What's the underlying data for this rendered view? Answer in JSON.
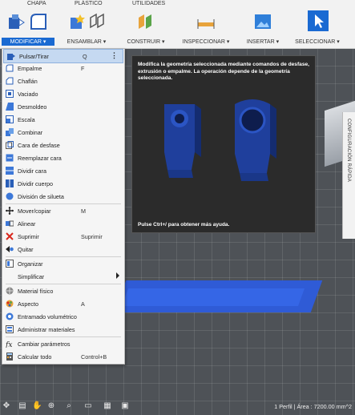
{
  "tabs": [
    "CHAPA",
    "PLÁSTICO",
    "UTILIDADES"
  ],
  "toolbar_groups": [
    {
      "label": "MODIFICAR ▾"
    },
    {
      "label": "ENSAMBLAR ▾"
    },
    {
      "label": "CONSTRUIR ▾"
    },
    {
      "label": "INSPECCIONAR ▾"
    },
    {
      "label": "INSERTAR ▾"
    },
    {
      "label": "SELECCIONAR ▾"
    }
  ],
  "menu": {
    "items": [
      {
        "label": "Pulsar/Tirar",
        "shortcut": "Q"
      },
      {
        "label": "Empalme",
        "shortcut": "F"
      },
      {
        "label": "Chaflán",
        "shortcut": ""
      },
      {
        "label": "Vaciado",
        "shortcut": ""
      },
      {
        "label": "Desmoldeo",
        "shortcut": ""
      },
      {
        "label": "Escala",
        "shortcut": ""
      },
      {
        "label": "Combinar",
        "shortcut": ""
      },
      {
        "label": "Cara de desfase",
        "shortcut": ""
      },
      {
        "label": "Reemplazar cara",
        "shortcut": ""
      },
      {
        "label": "Dividir cara",
        "shortcut": ""
      },
      {
        "label": "Dividir cuerpo",
        "shortcut": ""
      },
      {
        "label": "División de silueta",
        "shortcut": ""
      },
      {
        "label": "Mover/copiar",
        "shortcut": "M"
      },
      {
        "label": "Alinear",
        "shortcut": ""
      },
      {
        "label": "Suprimir",
        "shortcut": "Suprimir"
      },
      {
        "label": "Quitar",
        "shortcut": ""
      },
      {
        "label": "Organizar",
        "shortcut": ""
      },
      {
        "label": "Simplificar",
        "shortcut": ""
      },
      {
        "label": "Material físico",
        "shortcut": ""
      },
      {
        "label": "Aspecto",
        "shortcut": "A"
      },
      {
        "label": "Entramado volumétrico",
        "shortcut": ""
      },
      {
        "label": "Administrar materiales",
        "shortcut": ""
      },
      {
        "label": "Cambiar parámetros",
        "shortcut": ""
      },
      {
        "label": "Calcular todo",
        "shortcut": "Control+B"
      }
    ]
  },
  "tooltip": {
    "description": "Modifica la geometría seleccionada mediante comandos de desfase, extrusión o empalme. La operación depende de la geometría seleccionada.",
    "hint": "Pulse Ctrl+/ para obtener más ayuda."
  },
  "side_panel": {
    "label": "CONFIGURACIÓN RÁPIDA"
  },
  "status": "1 Perfil | Área : 7200.00 mm^2",
  "colors": {
    "accent": "#1a6ad2",
    "selected_item": "#c5d9f1",
    "model_blue": "#1f3f9c"
  }
}
